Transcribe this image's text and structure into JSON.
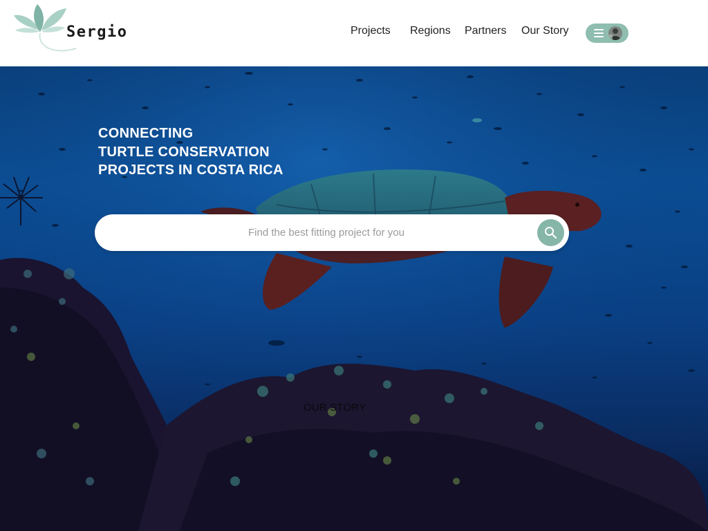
{
  "brand": {
    "name": "Sergio",
    "logo_icon": "lotus-leaf-icon",
    "accent": "#8fbdb0"
  },
  "nav": {
    "items": [
      {
        "label": "Projects"
      },
      {
        "label": "Regions"
      },
      {
        "label": "Partners"
      },
      {
        "label": "Our Story"
      }
    ],
    "menu_icon": "hamburger-icon",
    "avatar_icon": "user-avatar"
  },
  "hero": {
    "headline": [
      "CONNECTING",
      "TURTLE CONSERVATION",
      "PROJECTS IN COSTA RICA"
    ],
    "search": {
      "placeholder": "Find the best fitting project for you",
      "value": "",
      "icon": "search-icon"
    },
    "our_story_link": "OUR STORY"
  }
}
